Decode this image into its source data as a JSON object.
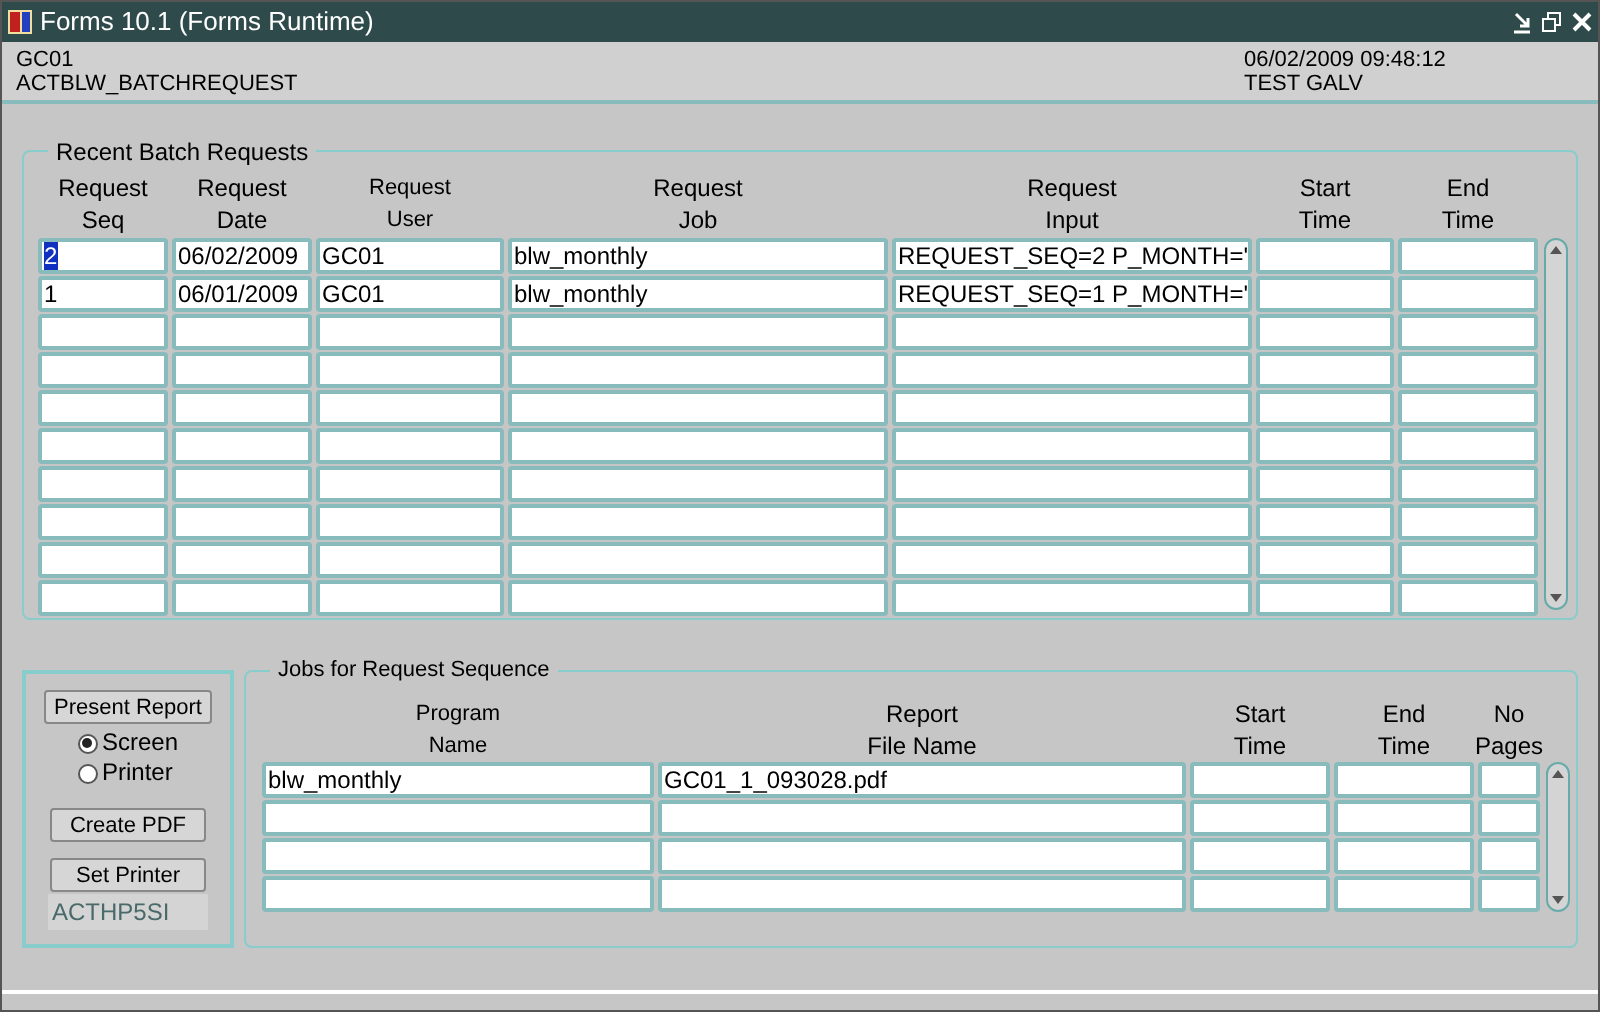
{
  "window": {
    "title": "Forms 10.1 (Forms Runtime)"
  },
  "header": {
    "left": [
      "GC01",
      "ACTBLW_BATCHREQUEST"
    ],
    "right": [
      "06/02/2009 09:48:12",
      "TEST GALV"
    ]
  },
  "batch_requests": {
    "title": "Recent Batch Requests",
    "columns": [
      {
        "lines": [
          "Request",
          "Seq"
        ],
        "small": false
      },
      {
        "lines": [
          "Request",
          "Date"
        ],
        "small": false
      },
      {
        "lines": [
          "Request",
          "User"
        ],
        "small": true
      },
      {
        "lines": [
          "Request",
          "Job"
        ],
        "small": false
      },
      {
        "lines": [
          "Request",
          "Input"
        ],
        "small": false
      },
      {
        "lines": [
          "Start",
          "Time"
        ],
        "small": false
      },
      {
        "lines": [
          "End",
          "Time"
        ],
        "small": false
      }
    ],
    "rows": [
      {
        "cells": [
          "2",
          "06/02/2009",
          "GC01",
          "blw_monthly",
          "REQUEST_SEQ=2 P_MONTH='"
        ],
        "selected": true
      },
      {
        "cells": [
          "1",
          "06/01/2009",
          "GC01",
          "blw_monthly",
          "REQUEST_SEQ=1 P_MONTH='"
        ],
        "selected": false
      }
    ]
  },
  "report_options": {
    "buttons": [
      "Present Report",
      "Create PDF",
      "Set Printer"
    ],
    "destinations": [
      {
        "label": "Screen",
        "selected": true
      },
      {
        "label": "Printer",
        "selected": false
      }
    ],
    "printer": "ACTHP5SI"
  },
  "jobs": {
    "title": "Jobs for Request Sequence",
    "columns": [
      {
        "lines": [
          "Program",
          "Name"
        ],
        "small": true
      },
      {
        "lines": [
          "Report",
          "File Name"
        ],
        "small": false
      },
      {
        "lines": [
          "Start",
          "Time"
        ],
        "small": false
      },
      {
        "lines": [
          "End",
          "Time"
        ],
        "small": false
      },
      {
        "lines": [
          "No",
          "Pages"
        ],
        "small": false
      }
    ],
    "rows": [
      {
        "cells": [
          "blw_monthly",
          "GC01_1_093028.pdf"
        ]
      }
    ]
  }
}
